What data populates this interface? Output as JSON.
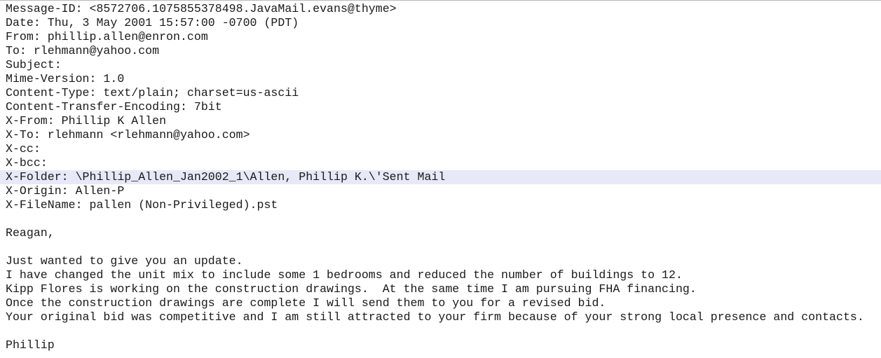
{
  "editor": {
    "current_line_index": 12,
    "current_line_color": "#e8e8f8",
    "text_color": "#1a1a1a",
    "lines": [
      "Message-ID: <8572706.1075855378498.JavaMail.evans@thyme>",
      "Date: Thu, 3 May 2001 15:57:00 -0700 (PDT)",
      "From: phillip.allen@enron.com",
      "To: rlehmann@yahoo.com",
      "Subject:",
      "Mime-Version: 1.0",
      "Content-Type: text/plain; charset=us-ascii",
      "Content-Transfer-Encoding: 7bit",
      "X-From: Phillip K Allen",
      "X-To: rlehmann <rlehmann@yahoo.com>",
      "X-cc:",
      "X-bcc:",
      "X-Folder: \\Phillip_Allen_Jan2002_1\\Allen, Phillip K.\\'Sent Mail",
      "X-Origin: Allen-P",
      "X-FileName: pallen (Non-Privileged).pst",
      "",
      "Reagan,",
      "",
      "Just wanted to give you an update.",
      "I have changed the unit mix to include some 1 bedrooms and reduced the number of buildings to 12.",
      "Kipp Flores is working on the construction drawings.  At the same time I am pursuing FHA financing.",
      "Once the construction drawings are complete I will send them to you for a revised bid.",
      "Your original bid was competitive and I am still attracted to your firm because of your strong local presence and contacts.",
      "",
      "Phillip"
    ]
  }
}
